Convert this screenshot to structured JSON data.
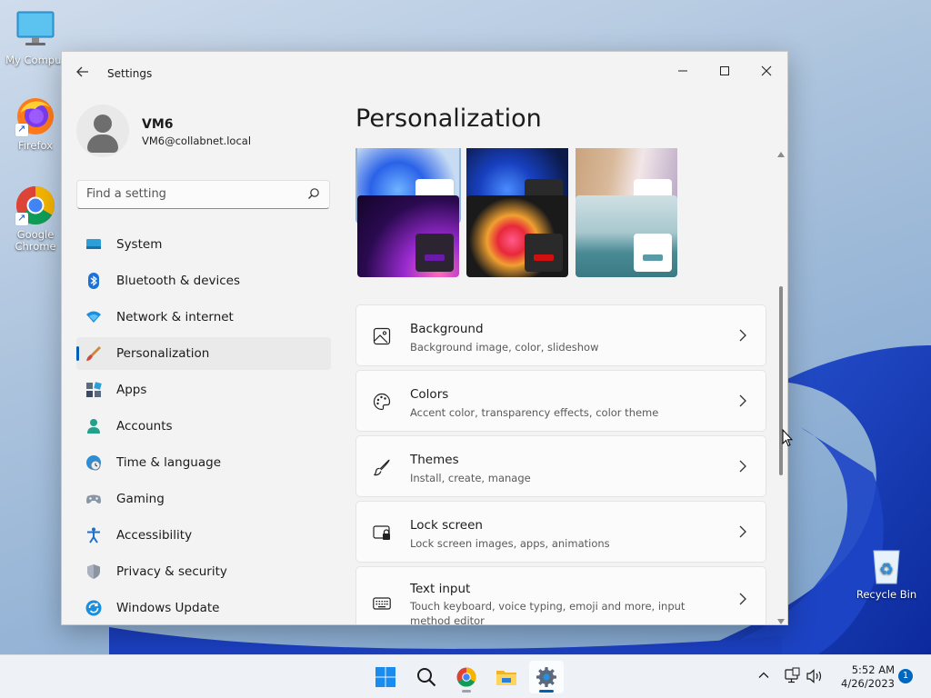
{
  "desktop": {
    "icons": [
      {
        "label": "My Comput"
      },
      {
        "label": "Firefox"
      },
      {
        "label": "Google Chrome"
      },
      {
        "label": "Recycle Bin"
      }
    ]
  },
  "window": {
    "title": "Settings",
    "controls": {
      "minimize": "—",
      "maximize": "□",
      "close": "✕"
    }
  },
  "profile": {
    "name": "VM6",
    "email": "VM6@collabnet.local"
  },
  "search": {
    "placeholder": "Find a setting"
  },
  "nav": {
    "items": [
      {
        "label": "System",
        "icon": "system-icon"
      },
      {
        "label": "Bluetooth & devices",
        "icon": "bluetooth-icon"
      },
      {
        "label": "Network & internet",
        "icon": "network-icon"
      },
      {
        "label": "Personalization",
        "icon": "personalization-icon",
        "active": true
      },
      {
        "label": "Apps",
        "icon": "apps-icon"
      },
      {
        "label": "Accounts",
        "icon": "accounts-icon"
      },
      {
        "label": "Time & language",
        "icon": "time-language-icon"
      },
      {
        "label": "Gaming",
        "icon": "gaming-icon"
      },
      {
        "label": "Accessibility",
        "icon": "accessibility-icon"
      },
      {
        "label": "Privacy & security",
        "icon": "privacy-icon"
      },
      {
        "label": "Windows Update",
        "icon": "windows-update-icon"
      }
    ]
  },
  "main": {
    "title": "Personalization",
    "cards": [
      {
        "title": "Background",
        "subtitle": "Background image, color, slideshow",
        "icon": "background-icon"
      },
      {
        "title": "Colors",
        "subtitle": "Accent color, transparency effects, color theme",
        "icon": "colors-icon"
      },
      {
        "title": "Themes",
        "subtitle": "Install, create, manage",
        "icon": "themes-icon"
      },
      {
        "title": "Lock screen",
        "subtitle": "Lock screen images, apps, animations",
        "icon": "lock-screen-icon"
      },
      {
        "title": "Text input",
        "subtitle": "Touch keyboard, voice typing, emoji and more, input method editor",
        "icon": "keyboard-icon"
      }
    ]
  },
  "taskbar": {
    "time": "5:52 AM",
    "date": "4/26/2023",
    "notification_count": "1"
  },
  "colors": {
    "accent": "#005fb8"
  }
}
